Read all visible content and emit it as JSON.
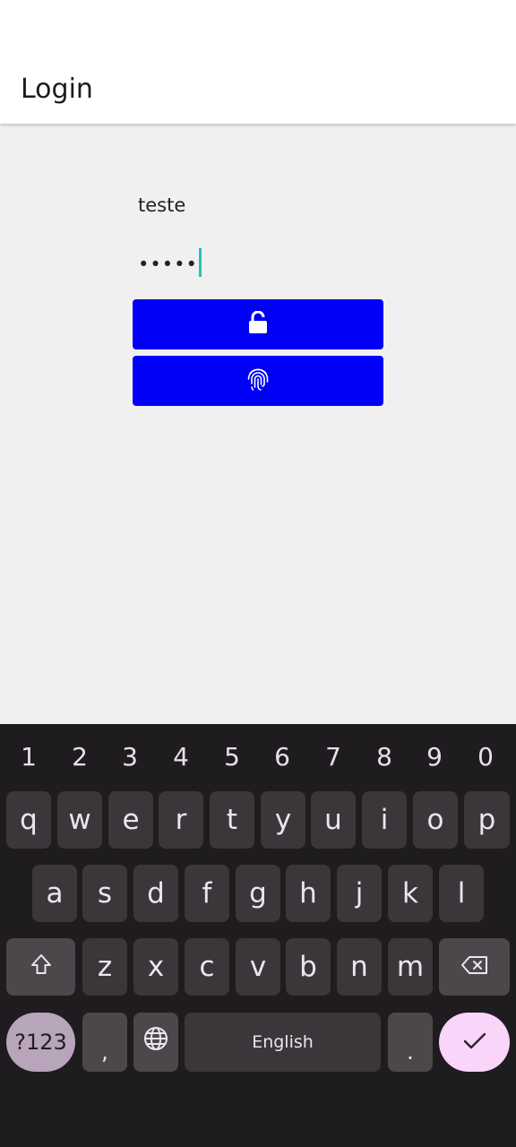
{
  "appbar": {
    "title": "Login"
  },
  "form": {
    "username_value": "teste",
    "password_value": "•••••"
  },
  "buttons": {
    "unlock_icon": "unlock-icon",
    "fingerprint_icon": "fingerprint-icon",
    "color": "#0000f8"
  },
  "keyboard": {
    "number_row": [
      "1",
      "2",
      "3",
      "4",
      "5",
      "6",
      "7",
      "8",
      "9",
      "0"
    ],
    "row1": [
      "q",
      "w",
      "e",
      "r",
      "t",
      "y",
      "u",
      "i",
      "o",
      "p"
    ],
    "row2": [
      "a",
      "s",
      "d",
      "f",
      "g",
      "h",
      "j",
      "k",
      "l"
    ],
    "row3": [
      "z",
      "x",
      "c",
      "v",
      "b",
      "n",
      "m"
    ],
    "symbols_label": "?123",
    "comma_label": ",",
    "space_label": "English",
    "period_label": "."
  }
}
